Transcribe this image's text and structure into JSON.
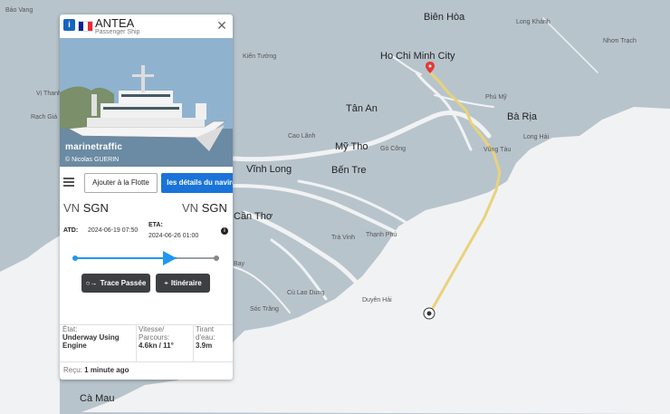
{
  "map": {
    "labels": {
      "ba_vang": "Bảo Vang",
      "bien_hoa": "Biên Hòa",
      "long_khanh": "Long Khánh",
      "nhon_trach": "Nhơn Trạch",
      "ho_chi_minh_city": "Ho Chi Minh City",
      "kien_tuong": "Kiến Tường",
      "tan_an": "Tân An",
      "phu_my": "Phú Mỹ",
      "ba_ria": "Bà Rịa",
      "vung_tau": "Vũng Tàu",
      "long_hai": "Long Hải",
      "cao_lanh": "Cao Lãnh",
      "my_tho": "Mỹ Tho",
      "go_cong": "Gò Công",
      "vinh_long": "Vĩnh Long",
      "ben_tre": "Bến Tre",
      "tra_vinh": "Trà Vinh",
      "thanh_phu": "Thạnh Phú",
      "can_tho": "Cần Thơ",
      "bay": "Bay",
      "dung": "Cù Lao Dung",
      "duyen_hai": "Duyên Hải",
      "soc_trang": "Sóc Trăng",
      "vi_thanh": "Vị Thanh",
      "rach_gia": "Rạch Giá",
      "ca_mau": "Cà Mau"
    }
  },
  "panel": {
    "vessel_name": "ANTEA",
    "vessel_type": "Passenger Ship",
    "type_icon": "ship-type-icon",
    "flag_colors": [
      "#002395",
      "#ffffff",
      "#ed2939"
    ],
    "watermark": "marinetraffic",
    "photo_credit": "© Nicolas GUERIN",
    "add_fleet_label": "Ajouter à la Flotte",
    "details_label": "les détails du navire",
    "origin": {
      "country": "VN",
      "port": "SGN"
    },
    "destination": {
      "country": "VN",
      "port": "SGN"
    },
    "atd_label": "ATD:",
    "atd_value": "2024-06-19 07:50",
    "eta_label": "ETA:",
    "eta_value": "2024-06-26 01:00",
    "progress": 0.72,
    "past_track_label": "Trace Passée",
    "route_label": "Itinéraire",
    "status_label": "État:",
    "status_value": "Underway Using Engine",
    "speed_label": "Vitesse/ Parcours:",
    "speed_value": "4.6kn / 11°",
    "draught_label": "Tirant d'eau:",
    "draught_value": "3.9m",
    "received_label": "Reçu:",
    "received_value": "1 minute ago"
  },
  "colors": {
    "sea": "#f1f2f4",
    "land": "#b8c4cc",
    "track": "#e8d37a",
    "accent": "#1a73d9"
  }
}
